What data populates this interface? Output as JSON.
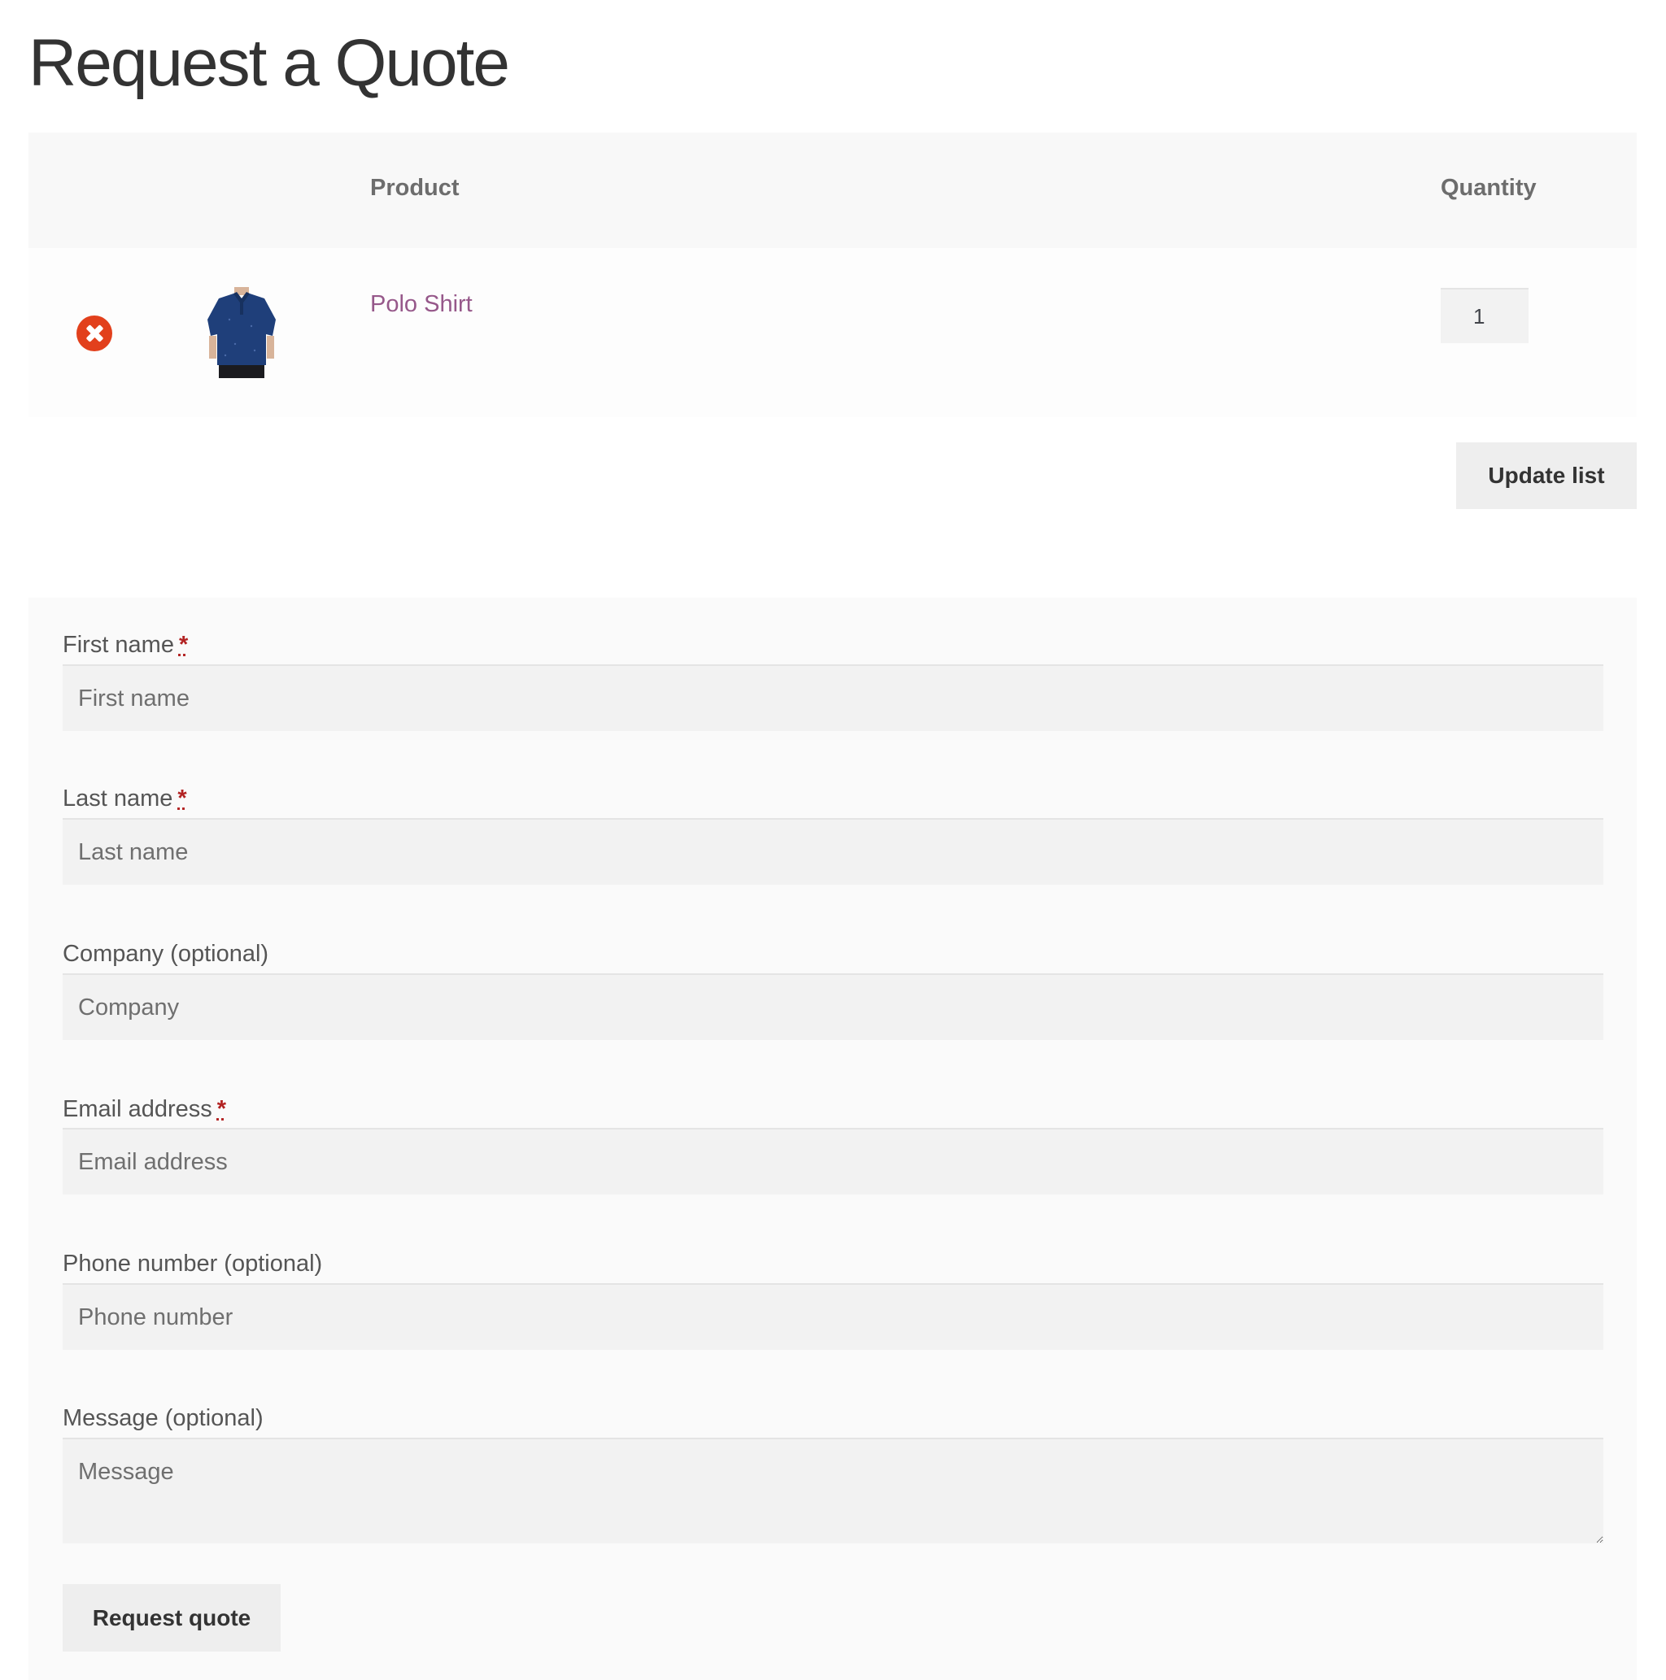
{
  "page": {
    "title": "Request a Quote"
  },
  "table": {
    "headers": {
      "product": "Product",
      "quantity": "Quantity"
    },
    "rows": [
      {
        "product_name": "Polo Shirt",
        "quantity": "1",
        "thumbnail_icon": "polo-shirt-thumbnail",
        "remove_icon": "remove-circle-icon"
      }
    ]
  },
  "actions": {
    "update_list_label": "Update list",
    "request_quote_label": "Request quote"
  },
  "form": {
    "required_marker": "*",
    "fields": {
      "first_name": {
        "label": "First name",
        "placeholder": "First name"
      },
      "last_name": {
        "label": "Last name",
        "placeholder": "Last name"
      },
      "company": {
        "label": "Company (optional)",
        "placeholder": "Company"
      },
      "email": {
        "label": "Email address",
        "placeholder": "Email address"
      },
      "phone": {
        "label": "Phone number (optional)",
        "placeholder": "Phone number"
      },
      "message": {
        "label": "Message (optional)",
        "placeholder": "Message"
      }
    }
  },
  "colors": {
    "link": "#96588a",
    "remove": "#e2401c",
    "required": "#b22222",
    "input_bg": "#f2f2f2",
    "button_bg": "#eeeeee"
  }
}
